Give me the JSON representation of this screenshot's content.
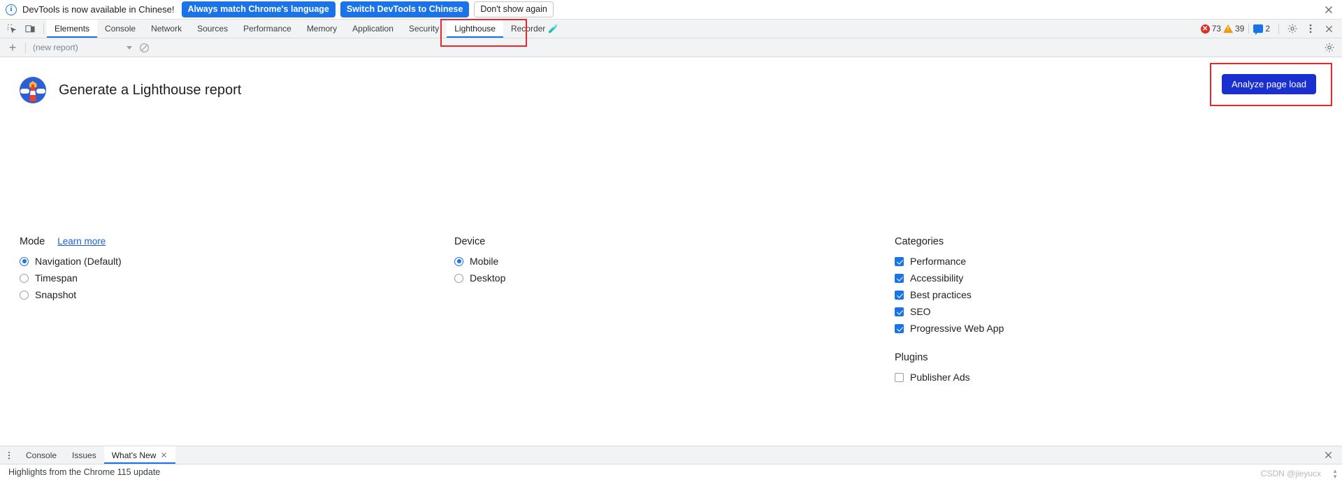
{
  "infobar": {
    "icon": "info-icon",
    "message": "DevTools is now available in Chinese!",
    "primary_button": "Always match Chrome's language",
    "secondary_button": "Switch DevTools to Chinese",
    "dismiss_button": "Don't show again",
    "close": "✕"
  },
  "tabstrip": {
    "tool_icons": [
      "inspect-element-icon",
      "device-toolbar-icon"
    ],
    "tabs": [
      {
        "label": "Elements",
        "active": false,
        "experimental": false
      },
      {
        "label": "Console",
        "active": false,
        "experimental": false
      },
      {
        "label": "Network",
        "active": false,
        "experimental": false
      },
      {
        "label": "Sources",
        "active": false,
        "experimental": false
      },
      {
        "label": "Performance",
        "active": false,
        "experimental": false
      },
      {
        "label": "Memory",
        "active": false,
        "experimental": false
      },
      {
        "label": "Application",
        "active": false,
        "experimental": false
      },
      {
        "label": "Security",
        "active": false,
        "experimental": false
      },
      {
        "label": "Lighthouse",
        "active": true,
        "experimental": false
      },
      {
        "label": "Recorder",
        "active": false,
        "experimental": true
      }
    ],
    "counters": {
      "errors": "73",
      "warnings": "39",
      "messages": "2"
    },
    "settings_icon": "gear-icon",
    "more_icon": "kebab-menu-icon",
    "close_icon": "close-icon",
    "highlight_color": "#e8282b"
  },
  "lighthouse_toolbar": {
    "add_label": "+",
    "report_select_value": "(new report)",
    "clear_icon": "clear-icon",
    "settings_icon": "gear-icon"
  },
  "lighthouse": {
    "logo": "lighthouse-logo-icon",
    "title": "Generate a Lighthouse report",
    "analyze_button": "Analyze page load",
    "analyze_button_color": "#1a2fd0",
    "mode": {
      "title": "Mode",
      "learn_more": "Learn more",
      "options": [
        {
          "label": "Navigation (Default)",
          "selected": true
        },
        {
          "label": "Timespan",
          "selected": false
        },
        {
          "label": "Snapshot",
          "selected": false
        }
      ]
    },
    "device": {
      "title": "Device",
      "options": [
        {
          "label": "Mobile",
          "selected": true
        },
        {
          "label": "Desktop",
          "selected": false
        }
      ]
    },
    "categories": {
      "title": "Categories",
      "options": [
        {
          "label": "Performance",
          "checked": true
        },
        {
          "label": "Accessibility",
          "checked": true
        },
        {
          "label": "Best practices",
          "checked": true
        },
        {
          "label": "SEO",
          "checked": true
        },
        {
          "label": "Progressive Web App",
          "checked": true
        }
      ]
    },
    "plugins": {
      "title": "Plugins",
      "options": [
        {
          "label": "Publisher Ads",
          "checked": false
        }
      ]
    }
  },
  "drawer": {
    "menu_icon": "kebab-menu-icon",
    "tabs": [
      {
        "label": "Console",
        "active": false,
        "closable": false
      },
      {
        "label": "Issues",
        "active": false,
        "closable": false
      },
      {
        "label": "What's New",
        "active": true,
        "closable": true
      }
    ],
    "close_label": "✕",
    "close_icon": "close-icon",
    "body_text": "Highlights from the Chrome 115 update"
  },
  "watermark": "CSDN @jieyucx",
  "accent_color": "#1a73e8"
}
